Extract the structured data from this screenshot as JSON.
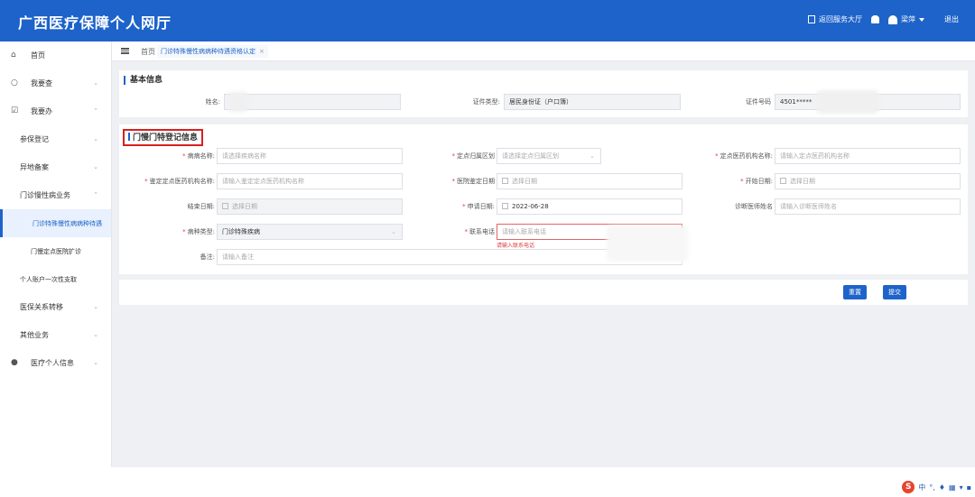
{
  "header": {
    "app_title": "广西医疗保障个人网厅",
    "back_label": "返回服务大厅",
    "user_name": "梁萍",
    "logout_label": "退出"
  },
  "sidebar": {
    "items": [
      {
        "label": "首页"
      },
      {
        "label": "我要查"
      },
      {
        "label": "我要办"
      },
      {
        "label": "参保登记"
      },
      {
        "label": "异地备案"
      },
      {
        "label": "门诊慢性病业务"
      },
      {
        "label": "门诊特殊慢性病病种待遇"
      },
      {
        "label": "门慢定点医院扩诊"
      },
      {
        "label": "个人账户一次性支取"
      },
      {
        "label": "医保关系转移"
      },
      {
        "label": "其他业务"
      },
      {
        "label": "医疗个人信息"
      }
    ]
  },
  "breadcrumb": {
    "home": "首页",
    "tab": "门诊特殊慢性病病种待遇资格认定"
  },
  "basic": {
    "title": "基本信息",
    "name_label": "姓名:",
    "idtype_label": "证件类型:",
    "idtype_value": "居民身份证（户口簿）",
    "idno_label": "证件号码",
    "idno_value": "4501*****"
  },
  "reg": {
    "title": "门慢门特登记信息",
    "disease_label": "病病名称:",
    "disease_ph": "请选择疾病名称",
    "region_label": "定点归属区划",
    "region_ph": "请选择定点归属区划",
    "hosp_label": "定点医药机构名称:",
    "hosp_ph": "请输入定点医药机构名称",
    "appr_hosp_label": "鉴定定点医药机构名称:",
    "appr_hosp_ph": "请输入鉴定定点医药机构名称",
    "appr_date_label": "医院鉴定日期",
    "date_ph": "选择日期",
    "start_label": "开始日期:",
    "end_label": "结束日期:",
    "apply_label": "申请日期:",
    "apply_value": "2022-06-28",
    "doctor_label": "诊断医师姓名",
    "doctor_ph": "请输入诊断医师姓名",
    "type_label": "病种类型:",
    "type_value": "门诊特殊疾病",
    "phone_label": "联系电话",
    "phone_ph": "请输入联系电话",
    "phone_err": "请输入联系电话",
    "remark_label": "备注:",
    "remark_ph": "请输入备注"
  },
  "actions": {
    "reset": "重置",
    "submit": "提交"
  },
  "taskbar": {
    "ime": "S",
    "ime_lang": "中"
  }
}
